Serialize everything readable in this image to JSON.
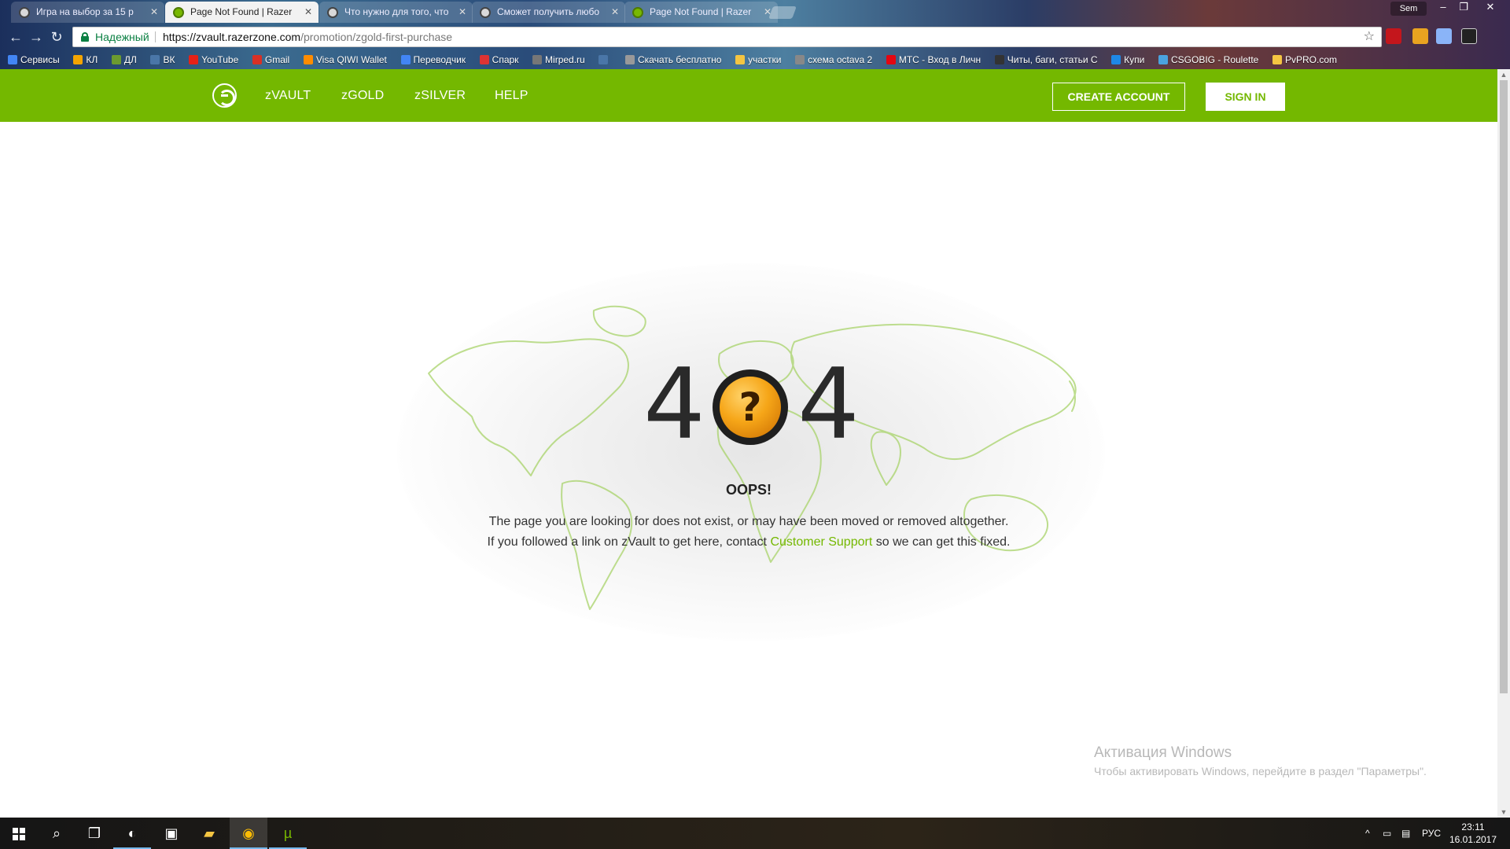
{
  "browser": {
    "tabs": [
      {
        "title": "Игра на выбор за 15 р",
        "icon": "mask-icon",
        "active": false
      },
      {
        "title": "Page Not Found | Razer",
        "icon": "razer-icon",
        "active": true
      },
      {
        "title": "Что нужно для того, что",
        "icon": "mask-icon",
        "active": false
      },
      {
        "title": "Сможет получить любо",
        "icon": "mask-icon",
        "active": false
      },
      {
        "title": "Page Not Found | Razer",
        "icon": "razer-icon",
        "active": false
      }
    ],
    "profile_name": "Sem",
    "security_label": "Надежный",
    "url_host": "https://zvault.razerzone.com",
    "url_path": "/promotion/zgold-first-purchase",
    "bookmarks": [
      {
        "label": "Сервисы",
        "color": "#4285f4"
      },
      {
        "label": "КЛ",
        "color": "#f4a400"
      },
      {
        "label": "ДЛ",
        "color": "#6c9a2f"
      },
      {
        "label": "ВК",
        "color": "#4a76a8"
      },
      {
        "label": "YouTube",
        "color": "#e62117"
      },
      {
        "label": "Gmail",
        "color": "#d93025"
      },
      {
        "label": "Visa QIWI Wallet",
        "color": "#ff8c00"
      },
      {
        "label": "Переводчик",
        "color": "#4285f4"
      },
      {
        "label": "Спарк",
        "color": "#d33"
      },
      {
        "label": "Mirped.ru",
        "color": "#777"
      },
      {
        "label": "",
        "color": "#4a76a8"
      },
      {
        "label": "Скачать бесплатно",
        "color": "#999"
      },
      {
        "label": "участки",
        "color": "#f4c542"
      },
      {
        "label": "схема octava 2",
        "color": "#888"
      },
      {
        "label": "МТС - Вход в Личн",
        "color": "#e30611"
      },
      {
        "label": "Читы, баги, статьи С",
        "color": "#333"
      },
      {
        "label": "Купи",
        "color": "#1e88e5"
      },
      {
        "label": "CSGOBIG - Roulette",
        "color": "#4aa3df"
      },
      {
        "label": "PvPRO.com",
        "color": "#f4c542"
      }
    ]
  },
  "site": {
    "nav": [
      {
        "label": "zVAULT"
      },
      {
        "label": "zGOLD"
      },
      {
        "label": "zSILVER"
      },
      {
        "label": "HELP"
      }
    ],
    "create_account": "CREATE ACCOUNT",
    "sign_in": "SIGN IN",
    "accent": "#74b800"
  },
  "error": {
    "digit_left": "4",
    "digit_right": "4",
    "coin_symbol": "?",
    "title": "OOPS!",
    "line1": "The page you are looking for does not exist, or may have been moved or removed altogether.",
    "line2_prefix": "If you followed a link on zVault to get here, contact ",
    "line2_link": "Customer Support",
    "line2_suffix": " so we can get this fixed."
  },
  "windows": {
    "activate_title": "Активация Windows",
    "activate_text": "Чтобы активировать Windows, перейдите в раздел \"Параметры\"."
  },
  "taskbar": {
    "language": "РУС",
    "time": "23:11",
    "date": "16.01.2017"
  }
}
